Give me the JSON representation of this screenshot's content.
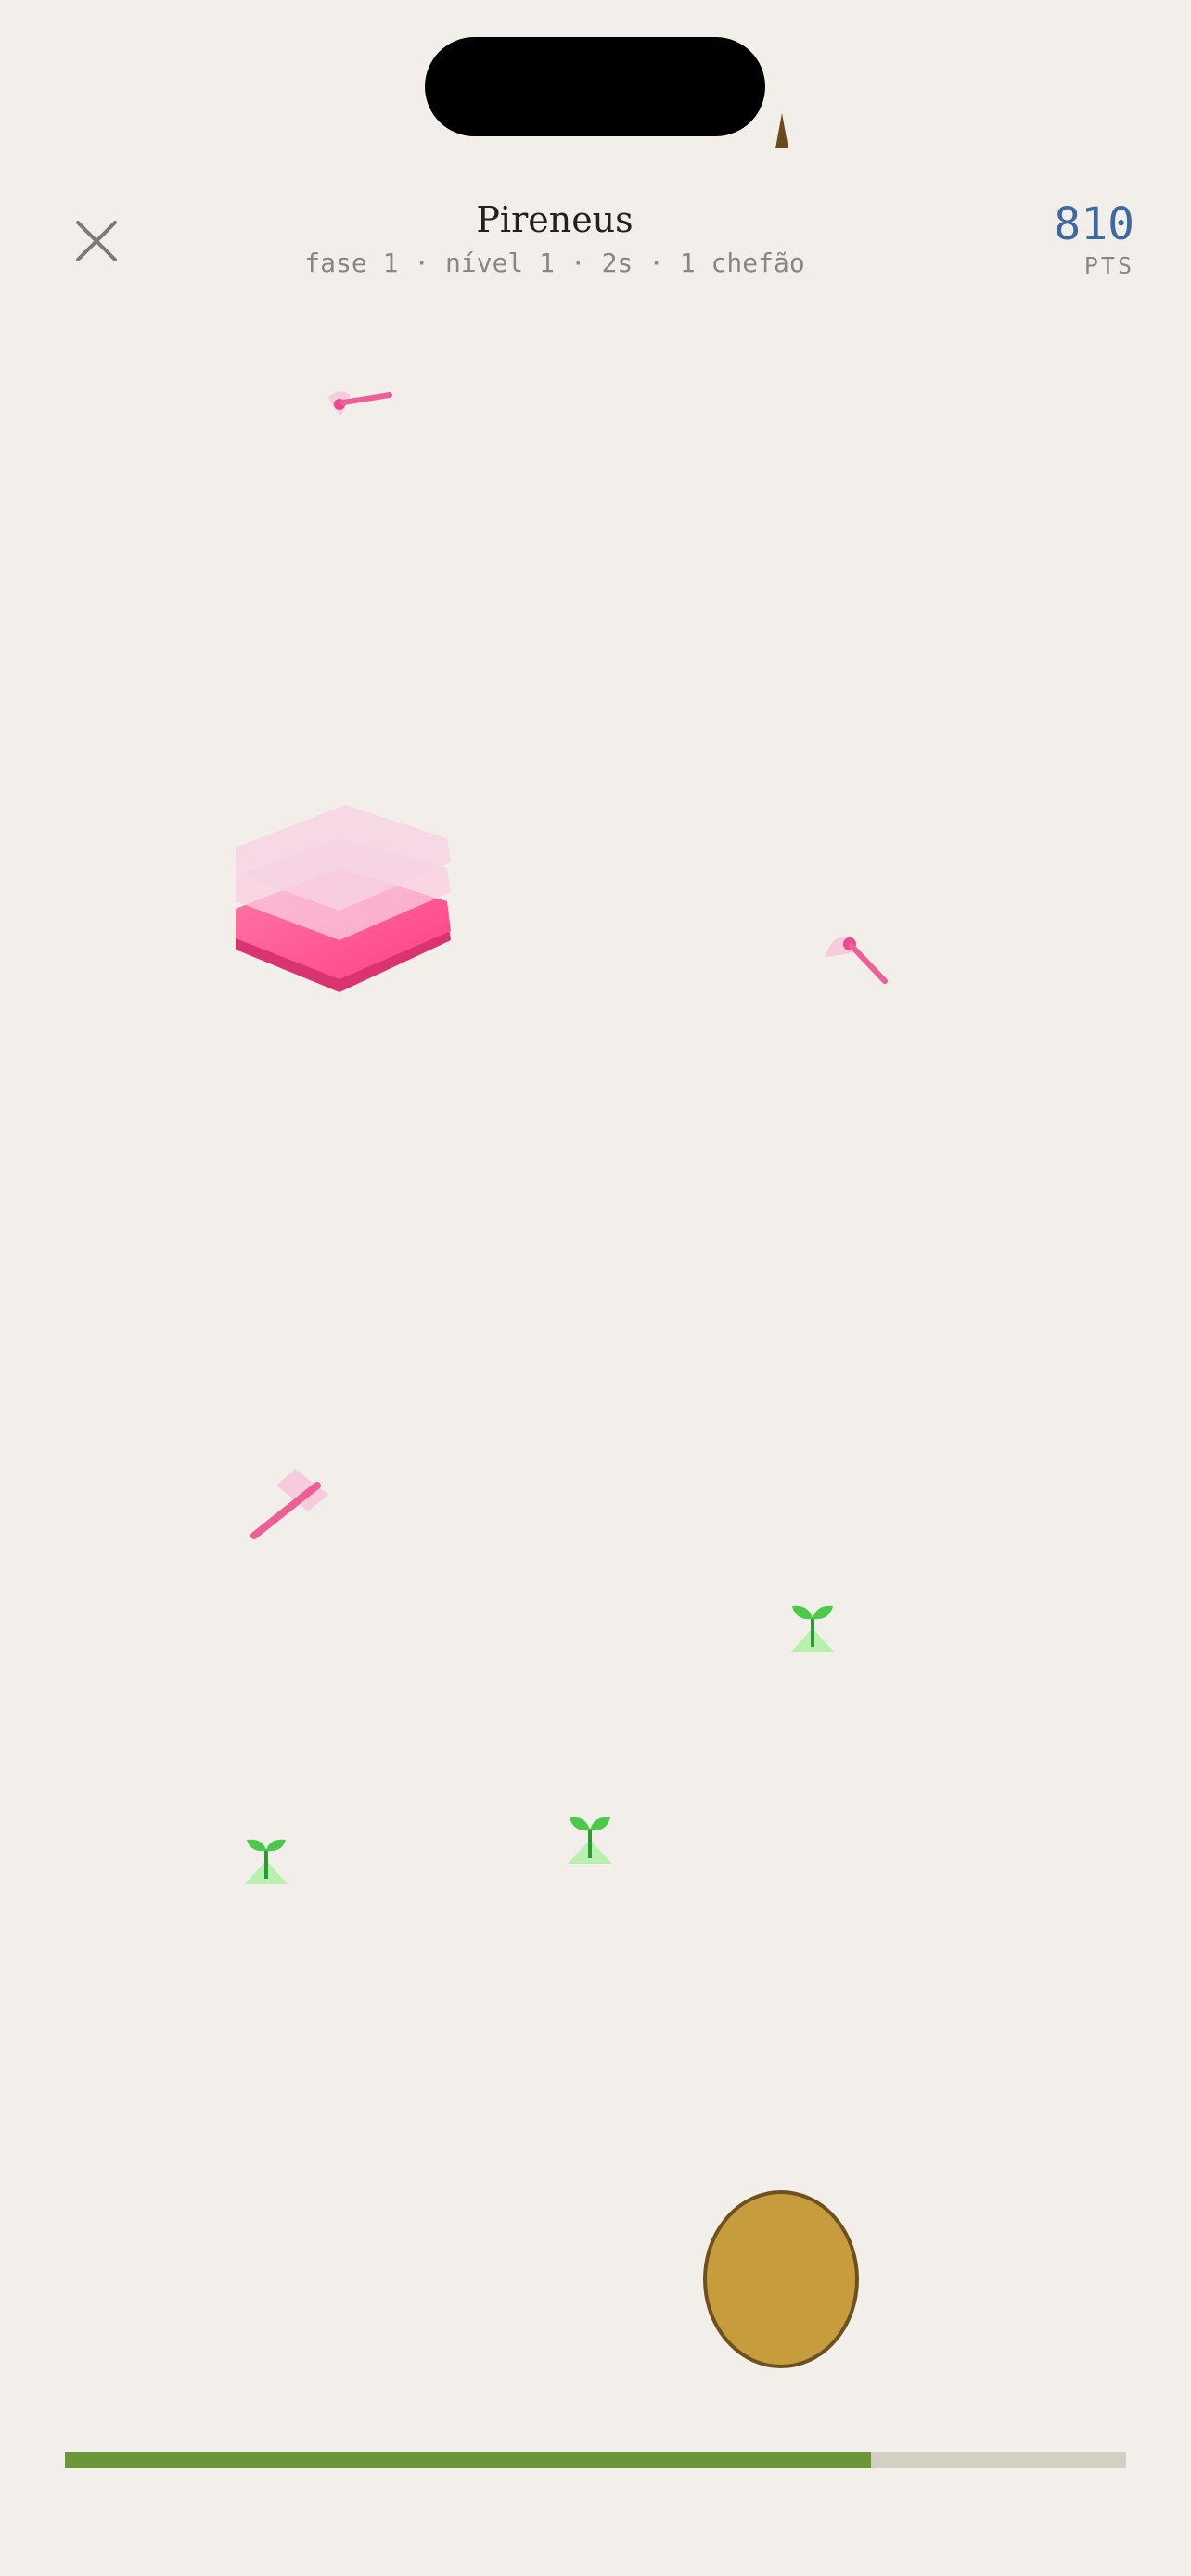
{
  "header": {
    "title": "Pireneus",
    "subtitle": "fase 1 · nível 1 · 2s · 1 chefão",
    "score": "810",
    "score_label": "PTS"
  },
  "progress": {
    "fraction": 0.76,
    "color": "#6b963a",
    "track_color": "#d4cfc3"
  },
  "colors": {
    "background": "#f2efea",
    "score": "#3d6aa0",
    "boss": "#ff4f93",
    "enemy": "#ef5f96",
    "sprout": "#4cc94a",
    "player": "#c79c3c"
  },
  "icons": {
    "close": "x-icon",
    "boss": "pink-layered-block-icon",
    "enemy": "pink-dart-icon",
    "pickup": "sprout-icon",
    "player": "golden-egg-icon"
  }
}
